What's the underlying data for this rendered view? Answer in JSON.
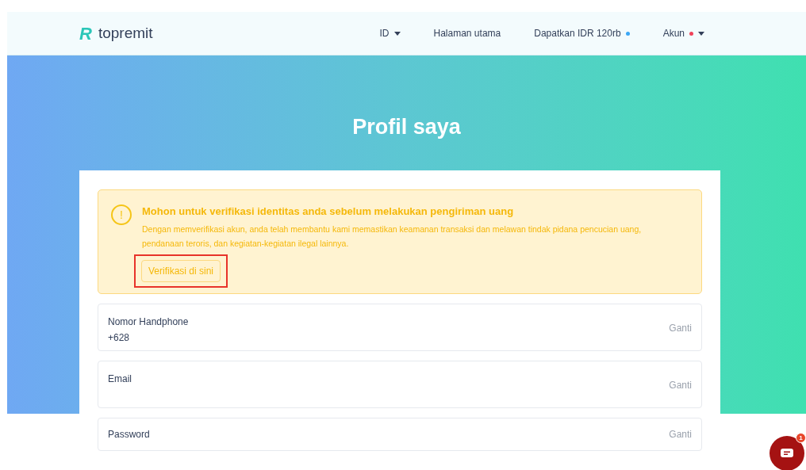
{
  "header": {
    "logo_mark": "R",
    "logo_text": "topremit",
    "nav": [
      {
        "label": "ID",
        "caret": true
      },
      {
        "label": "Halaman utama",
        "caret": false
      },
      {
        "label": "Dapatkan IDR 120rb",
        "caret": false,
        "color": "#3ba7f5"
      },
      {
        "label": "Akun",
        "caret": true,
        "color": "#f0435a"
      }
    ]
  },
  "title": "Profil saya",
  "alert": {
    "icon_text": "!",
    "heading": "Mohon untuk verifikasi identitas anda sebelum melakukan pengiriman uang",
    "body": "Dengan memverifikasi akun, anda telah membantu kami memastikan keamanan transaksi dan melawan tindak pidana pencucian uang, pendanaan teroris, dan kegiatan-kegiatan ilegal lainnya.",
    "button": "Verifikasi di sini",
    "highlighted": true
  },
  "fields": [
    {
      "label": "Nomor Handphone",
      "value": "+628",
      "action": "Ganti",
      "kind": "tall"
    },
    {
      "label": "Email",
      "action": "Ganti",
      "kind": "tall"
    },
    {
      "label": "Password",
      "action": "Ganti",
      "kind": "short"
    }
  ],
  "chat": {
    "badge": "1"
  }
}
